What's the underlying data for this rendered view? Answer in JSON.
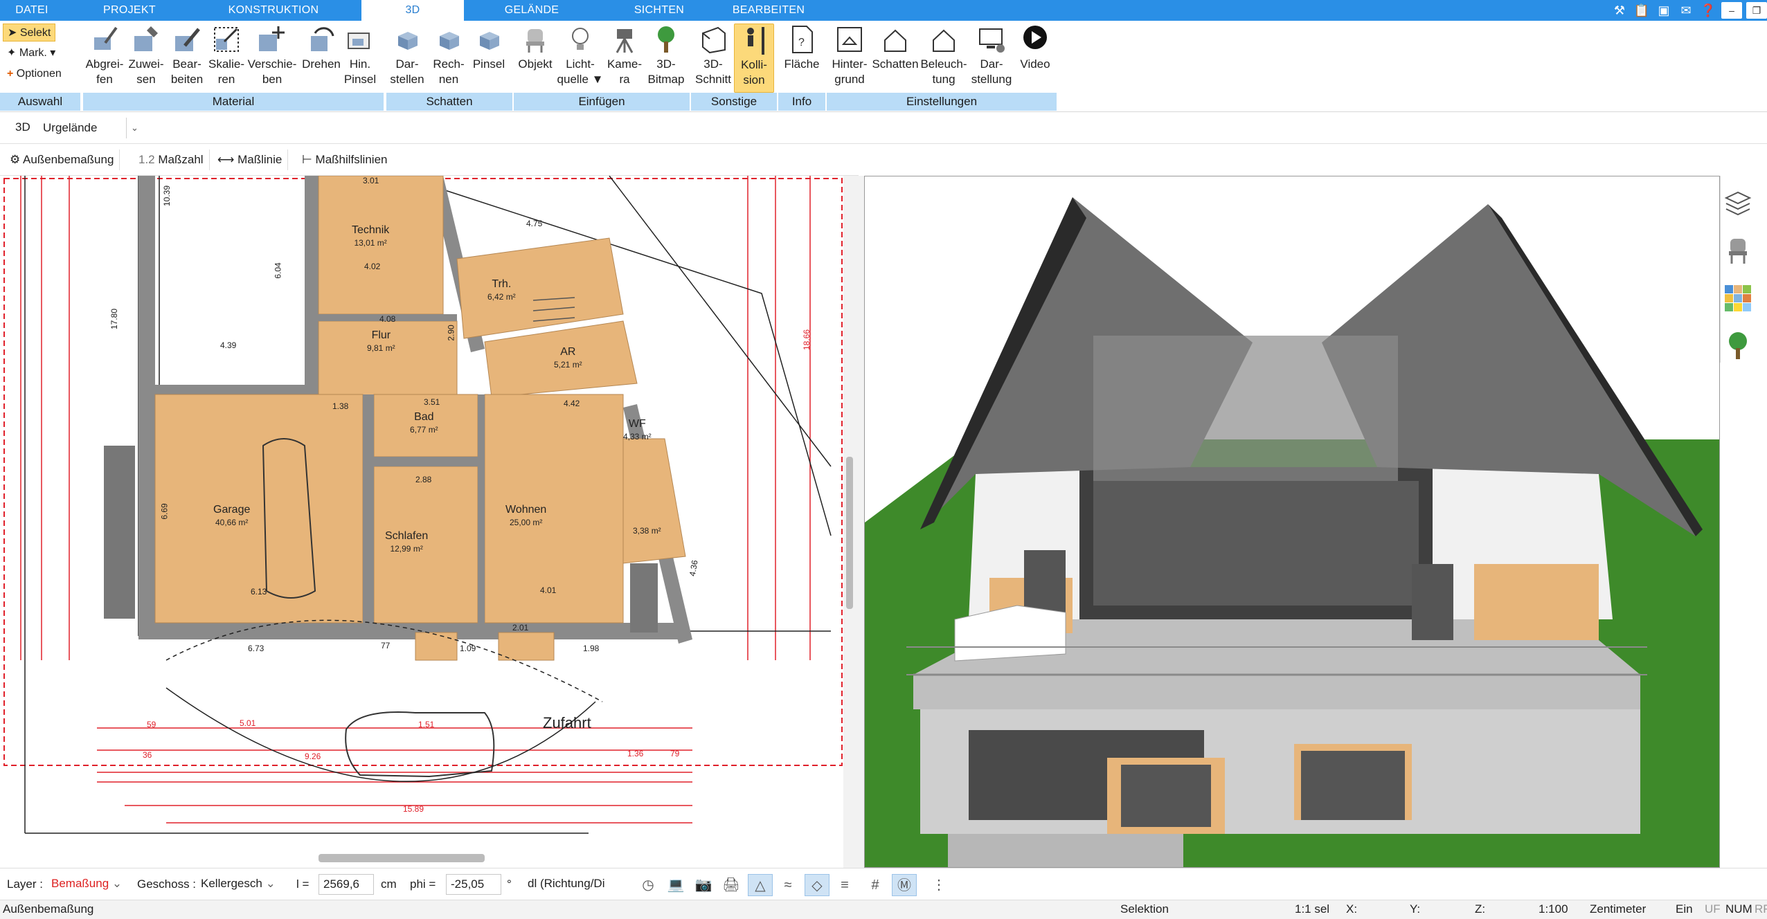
{
  "tabs": [
    "DATEI",
    "PROJEKT",
    "KONSTRUKTION",
    "3D",
    "GELÄNDE",
    "SICHTEN",
    "BEARBEITEN"
  ],
  "active_tab": "3D",
  "auswahl": {
    "select": "Selekt",
    "mark": "Mark.",
    "options": "Optionen",
    "label": "Auswahl"
  },
  "material": {
    "buttons": [
      {
        "top": "Abgrei-",
        "bottom": "fen"
      },
      {
        "top": "Zuwei-",
        "bottom": "sen"
      },
      {
        "top": "Bear-",
        "bottom": "beiten"
      },
      {
        "top": "Skalie-",
        "bottom": "ren"
      },
      {
        "top": "Verschie-",
        "bottom": "ben"
      },
      {
        "top": "Drehen",
        "bottom": ""
      },
      {
        "top": "Hin.",
        "bottom": "Pinsel"
      }
    ],
    "label": "Material"
  },
  "schatten": {
    "buttons": [
      {
        "top": "Dar-",
        "bottom": "stellen"
      },
      {
        "top": "Rech-",
        "bottom": "nen"
      },
      {
        "top": "Pinsel",
        "bottom": ""
      }
    ],
    "label": "Schatten"
  },
  "einfuegen": {
    "buttons": [
      {
        "top": "Objekt",
        "bottom": ""
      },
      {
        "top": "Licht-",
        "bottom": "quelle"
      },
      {
        "top": "Kame-",
        "bottom": "ra"
      },
      {
        "top": "3D-",
        "bottom": "Bitmap"
      }
    ],
    "label": "Einfügen"
  },
  "sonstige": {
    "buttons": [
      {
        "top": "3D-",
        "bottom": "Schnitt"
      },
      {
        "top": "Kolli-",
        "bottom": "sion"
      }
    ],
    "label": "Sonstige"
  },
  "info": {
    "buttons": [
      {
        "top": "Fläche",
        "bottom": ""
      }
    ],
    "label": "Info"
  },
  "einstellungen": {
    "buttons": [
      {
        "top": "Hinter-",
        "bottom": "grund"
      },
      {
        "top": "Schatten",
        "bottom": ""
      },
      {
        "top": "Beleuch-",
        "bottom": "tung"
      },
      {
        "top": "Dar-",
        "bottom": "stellung"
      },
      {
        "top": "Video",
        "bottom": ""
      }
    ],
    "label": "Einstellungen"
  },
  "row2": {
    "mode": "3D",
    "terrain": "Urgelände"
  },
  "row3": {
    "btn1": "Außenbemaßung",
    "btn2_prefix": "1.2",
    "btn2": "Maßzahl",
    "btn3": "Maßlinie",
    "btn4": "Maßhilfslinien"
  },
  "plan": {
    "rooms": [
      {
        "name": "Technik",
        "area": "13,01 m²"
      },
      {
        "name": "Trh.",
        "area": "6,42 m²"
      },
      {
        "name": "Flur",
        "area": "9,81 m²"
      },
      {
        "name": "AR",
        "area": "5,21 m²"
      },
      {
        "name": "Bad",
        "area": "6,77 m²"
      },
      {
        "name": "WF",
        "area": "4,33 m²"
      },
      {
        "name": "Garage",
        "area": "40,66 m²"
      },
      {
        "name": "Schlafen",
        "area": "12,99 m²"
      },
      {
        "name": "Wohnen",
        "area": "25,00 m²"
      },
      {
        "name": "",
        "area": "3,38 m²"
      }
    ],
    "driveway": "Zufahrt",
    "dims": [
      "4.75",
      "4.39",
      "17.80",
      "18.66",
      "6.04",
      "4.02",
      "4.08",
      "2.90",
      "3.51",
      "4.42",
      "2.88",
      "6.69",
      "4.01",
      "6.73",
      "1.98",
      "6.13",
      "2.01",
      "5.01",
      "9.26",
      "15.89",
      "4.36",
      "10.39",
      "3.01",
      "1.38",
      "1.09",
      "1.51",
      "1.36",
      "77",
      "79",
      "36",
      "59"
    ]
  },
  "bottom": {
    "layer_label": "Layer :",
    "layer_value": "Bemaßung",
    "geschoss_label": "Geschoss :",
    "geschoss_value": "Kellergesch",
    "l_label": "l =",
    "l_value": "2569,6",
    "l_unit": "cm",
    "phi_label": "phi =",
    "phi_value": "-25,05",
    "phi_unit": "°",
    "dl_value": "dl (Richtung/Di"
  },
  "status": {
    "left": "Außenbemaßung",
    "mode": "Selektion",
    "sel": "1:1 sel",
    "x": "X:",
    "y": "Y:",
    "z": "Z:",
    "scale": "1:100",
    "unit": "Zentimeter",
    "ein": "Ein",
    "uf": "UF",
    "num": "NUM",
    "rf": "RF"
  },
  "colors": {
    "accent": "#2a8fe6",
    "group_label_bg": "#b9dcf7",
    "highlight": "#fcd97a",
    "floor": "#e7b57a",
    "wall": "#8a8a8a",
    "grass": "#3e8a2a",
    "roof": "#6f6f6f",
    "dim_red": "#e0202a"
  }
}
